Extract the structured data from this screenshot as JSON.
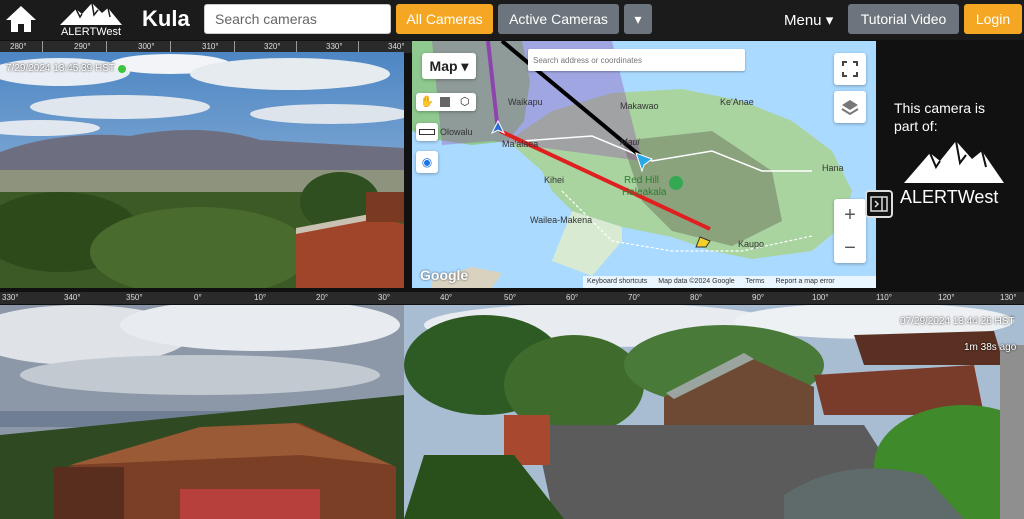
{
  "header": {
    "title": "Kula",
    "logo_text": "ALERTWest",
    "search_placeholder": "Search cameras",
    "all_cameras_label": "All Cameras",
    "active_cameras_label": "Active Cameras",
    "dropdown_label": "▾",
    "menu_label": "Menu ▾",
    "tutorial_label": "Tutorial Video",
    "login_label": "Login"
  },
  "compass_top": [
    "280°",
    "290°",
    "300°",
    "310°",
    "320°",
    "330°",
    "340°"
  ],
  "compass_bottom": [
    "330°",
    "340°",
    "350°",
    "0°",
    "10°",
    "20°",
    "30°",
    "40°",
    "50°",
    "60°",
    "70°",
    "80°",
    "90°",
    "100°",
    "110°",
    "120°",
    "130°"
  ],
  "main_camera": {
    "timestamp": "7/29/2024 13:45:39 HST",
    "status_color": "#3ec43e"
  },
  "right_camera": {
    "timestamp": "07/29/2024 13:44:26 HST",
    "age": "1m 38s ago"
  },
  "map": {
    "type_label": "Map ▾",
    "search_placeholder": "Search address or coordinates",
    "labels": {
      "waikapu": "Waikapu",
      "olowalu": "Olowalu",
      "maalaea": "Ma'alaea",
      "makawao": "Makawao",
      "keanae": "Ke'Anae",
      "maui": "Maui",
      "kihei": "Kihei",
      "red_hill": "Red Hill",
      "haleakala": "Haleakala",
      "hana": "Hana",
      "wailea": "Wailea-Makena",
      "kaupo": "Kaupo",
      "google": "Google"
    },
    "attribution": {
      "shortcuts": "Keyboard shortcuts",
      "data": "Map data ©2024 Google",
      "terms": "Terms",
      "report": "Report a map error"
    },
    "zoom_in": "+",
    "zoom_out": "−"
  },
  "side_panel": {
    "text": "This camera is part of:",
    "logo_text": "ALERTWest"
  },
  "colors": {
    "accent": "#f5a623",
    "secondary": "#6c757d",
    "sightline_red": "#e02020",
    "sightline_black": "#000000",
    "sightline_purple": "#8e44ad"
  }
}
